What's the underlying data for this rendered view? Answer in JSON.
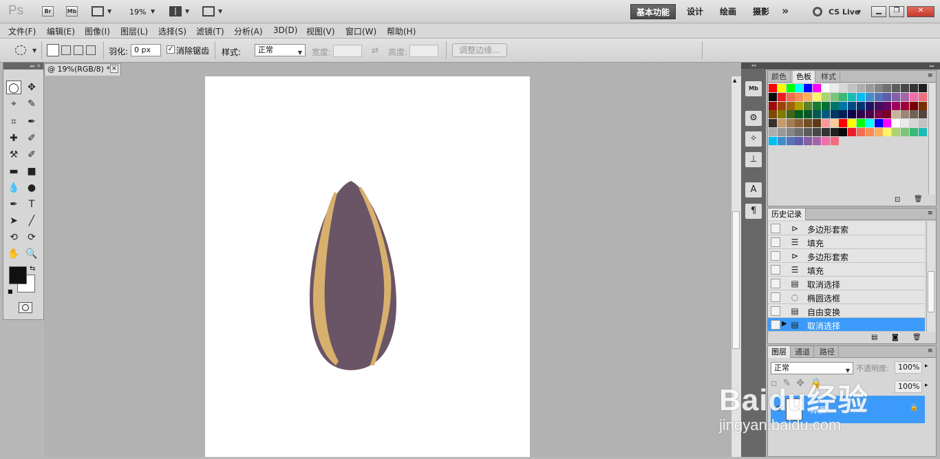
{
  "app": {
    "logo": "Ps",
    "bridge_label": "Br",
    "minibridge_label": "Mb",
    "zoom": "19%",
    "workspaces": [
      "基本功能",
      "设计",
      "绘画",
      "摄影"
    ],
    "more": "»",
    "cs_live": "CS Live"
  },
  "menu": [
    "文件(F)",
    "编辑(E)",
    "图像(I)",
    "图层(L)",
    "选择(S)",
    "滤镜(T)",
    "分析(A)",
    "3D(D)",
    "视图(V)",
    "窗口(W)",
    "帮助(H)"
  ],
  "options": {
    "feather_label": "羽化:",
    "feather_value": "0 px",
    "antialias_label": "消除锯齿",
    "style_label": "样式:",
    "style_value": "正常",
    "width_label": "宽度:",
    "height_label": "高度:",
    "refine_edge": "调整边缘..."
  },
  "document": {
    "tab_title": "@ 19%(RGB/8) *",
    "close": "×"
  },
  "tools": [
    "marquee-ellipse",
    "move",
    "lasso-polygon",
    "quick-select",
    "crop",
    "eyedropper",
    "healing",
    "brush",
    "clone-stamp",
    "history-brush",
    "eraser",
    "gradient",
    "blur",
    "dodge",
    "pen",
    "type",
    "path-select",
    "line",
    "3d-rotate",
    "3d-orbit",
    "hand",
    "zoom"
  ],
  "tool_glyphs": [
    "◯",
    "✥",
    "⌖",
    "✎",
    "⌗",
    "✒",
    "✚",
    "✐",
    "⚒",
    "✐",
    "▬",
    "■",
    "💧",
    "●",
    "✒",
    "T",
    "➤",
    "╱",
    "⟲",
    "⟳",
    "✋",
    "🔍"
  ],
  "colors": {
    "foreground": "#111111",
    "background": "#ffffff",
    "seed_body": "#6a5566",
    "seed_stripe": "#d8b06e",
    "history_selected": "#3c9bfa"
  },
  "swatch_panel": {
    "tabs": [
      "颜色",
      "色板",
      "样式"
    ],
    "active_tab": "色板"
  },
  "history": {
    "tab": "历史记录",
    "items": [
      {
        "label": "多边形套索",
        "icon": "lasso-icon"
      },
      {
        "label": "填充",
        "icon": "fill-icon"
      },
      {
        "label": "多边形套索",
        "icon": "lasso-icon"
      },
      {
        "label": "填充",
        "icon": "fill-icon"
      },
      {
        "label": "取消选择",
        "icon": "deselect-icon"
      },
      {
        "label": "椭圆选框",
        "icon": "ellipse-marquee-icon"
      },
      {
        "label": "自由变换",
        "icon": "transform-icon"
      },
      {
        "label": "取消选择",
        "icon": "deselect-icon"
      }
    ],
    "selected_index": 7
  },
  "layers": {
    "tabs": [
      "图层",
      "通道",
      "路径"
    ],
    "blend_mode": "正常",
    "opacity_label": "不透明度:",
    "opacity_value": "100%",
    "fill_value": "100%",
    "layer_name": "背景"
  },
  "watermark": {
    "brand": "Baidu经验",
    "url": "jingyan.baidu.com"
  }
}
